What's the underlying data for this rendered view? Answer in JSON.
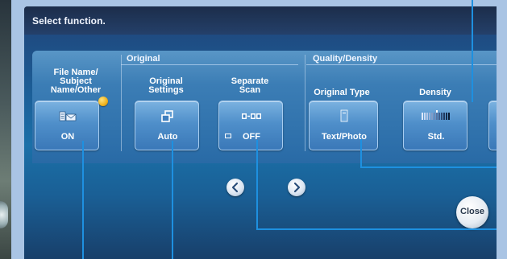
{
  "header": {
    "title": "Select function."
  },
  "groups": {
    "original": "Original",
    "quality_density": "Quality/Density"
  },
  "functions": [
    {
      "key": "file_name",
      "title": [
        "File Name/",
        "Subject",
        "Name/Other"
      ],
      "icon": "file-envelope-icon",
      "value": "ON"
    },
    {
      "key": "original_settings",
      "title": [
        "Original",
        "Settings"
      ],
      "icon": "stacked-pages-icon",
      "value": "Auto"
    },
    {
      "key": "separate_scan",
      "title": [
        "Separate",
        "Scan"
      ],
      "icon": "separate-scan-icon",
      "value": "OFF"
    },
    {
      "key": "original_type",
      "title": [
        "Original Type"
      ],
      "icon": "document-icon",
      "value": "Text/Photo"
    },
    {
      "key": "density",
      "title": [
        "Density"
      ],
      "icon": "density-scale-icon",
      "value": "Std."
    }
  ],
  "navigation": {
    "prev_symbol": "‹",
    "next_symbol": "›"
  },
  "close": {
    "label": "Close"
  },
  "colors": {
    "panel": "#1c5f98",
    "button": "#4f8fca",
    "callout": "#1e90e0",
    "indicator": "#f0b21c"
  }
}
